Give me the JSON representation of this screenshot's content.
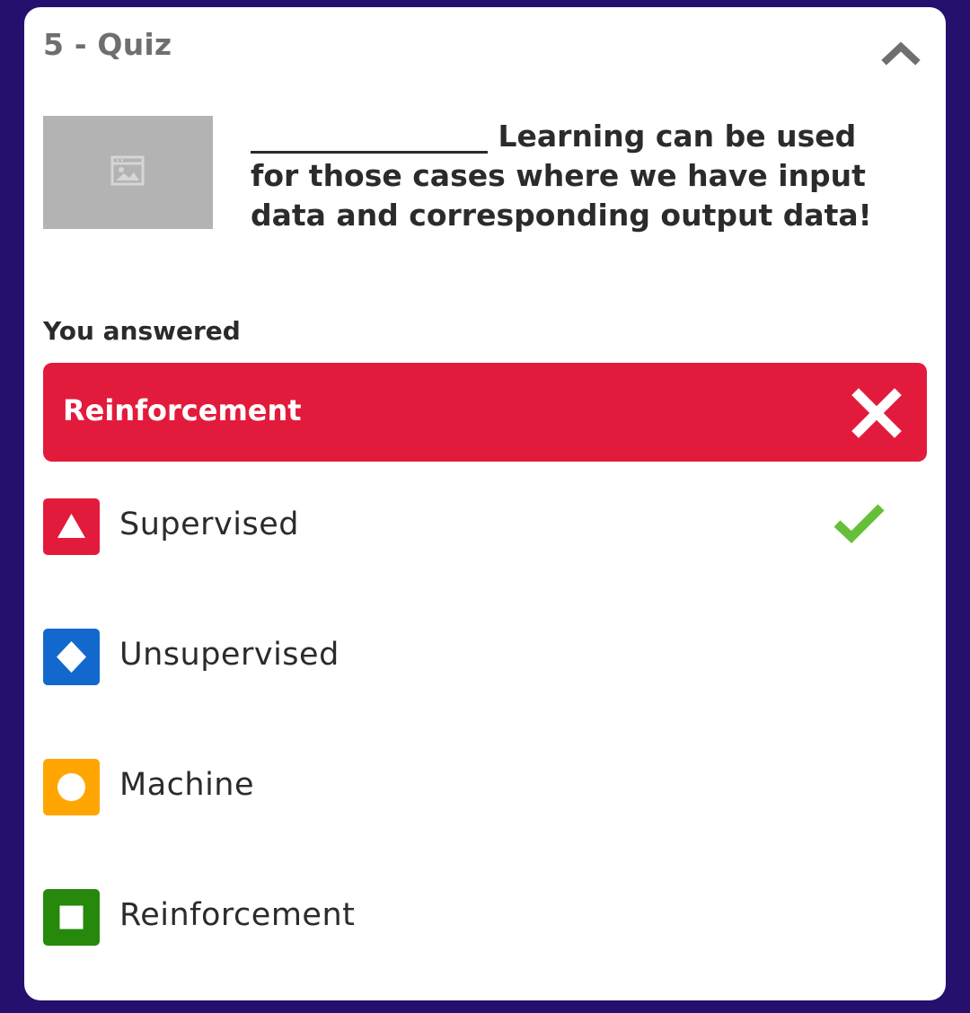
{
  "header": {
    "title": "5 - Quiz",
    "collapse_icon": "chevron-up-icon"
  },
  "question": {
    "image_icon": "image-placeholder-icon",
    "text": "________________ Learning can be used for those cases where we have input data and corresponding output data!"
  },
  "result": {
    "label": "You answered",
    "answer": "Reinforcement",
    "status_icon": "incorrect-x-icon",
    "color": "#e21b3c"
  },
  "options": [
    {
      "label": "Supervised",
      "shape": "triangle-icon",
      "color": "#e21b3c",
      "correct": true
    },
    {
      "label": "Unsupervised",
      "shape": "diamond-icon",
      "color": "#1368ce",
      "correct": false
    },
    {
      "label": "Machine",
      "shape": "circle-icon",
      "color": "#ffa602",
      "correct": false
    },
    {
      "label": "Reinforcement",
      "shape": "square-icon",
      "color": "#26890c",
      "correct": false
    }
  ],
  "correct_icon": "checkmark-icon",
  "colors": {
    "background": "#26106e",
    "card": "#ffffff",
    "correct": "#66bf39"
  }
}
